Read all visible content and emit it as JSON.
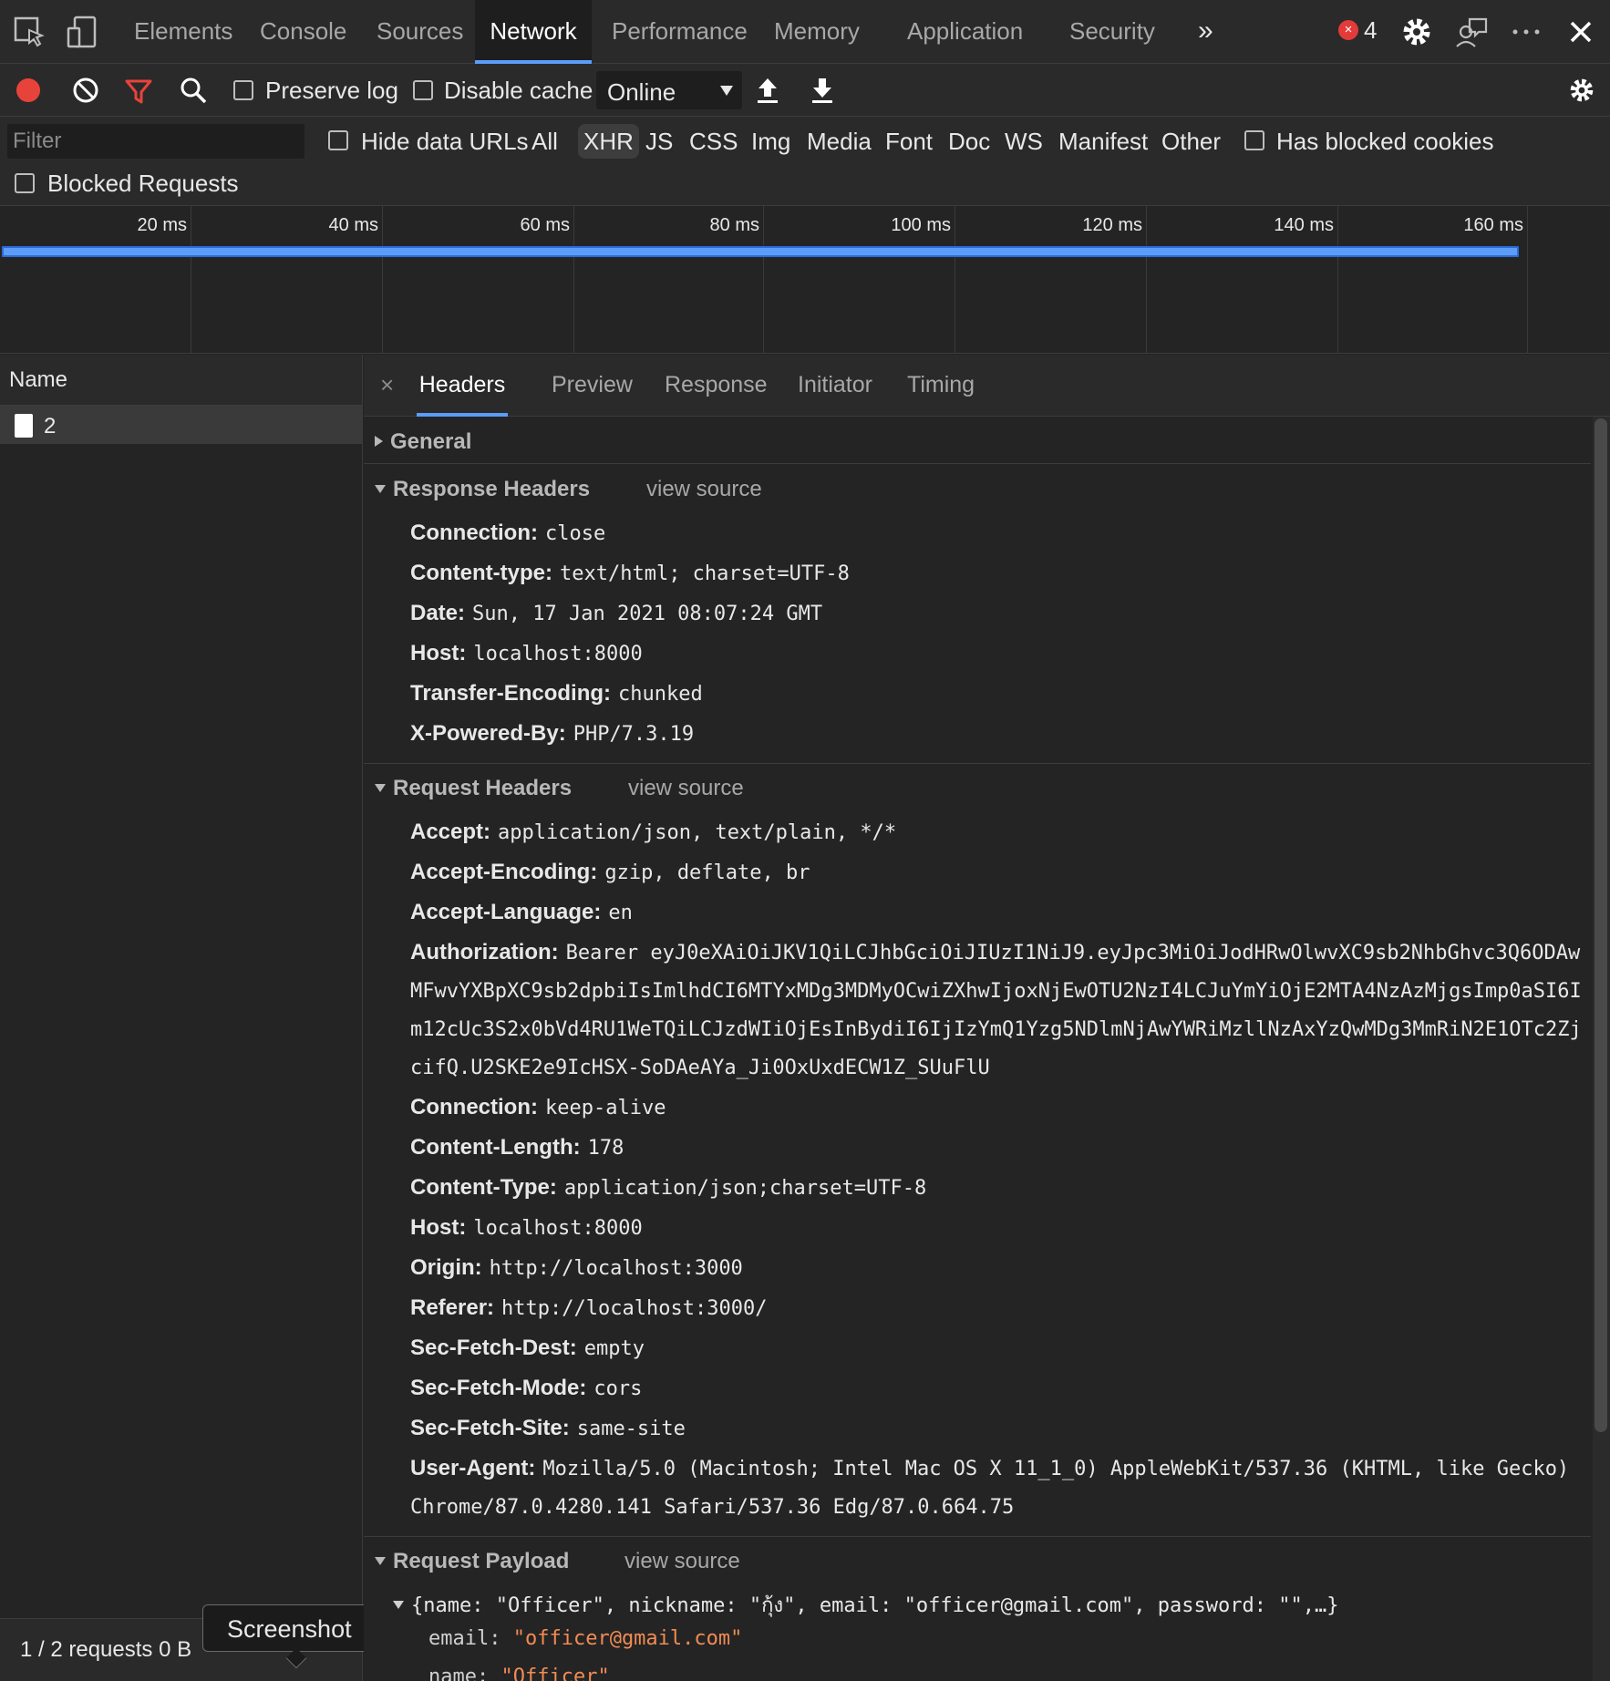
{
  "topbar": {
    "tabs": [
      "Elements",
      "Console",
      "Sources",
      "Network",
      "Performance",
      "Memory",
      "Application",
      "Security"
    ],
    "more": "»",
    "error_count": "4",
    "error_icon": "×"
  },
  "toolbar": {
    "preserve_log": "Preserve log",
    "disable_cache": "Disable cache",
    "throttle": "Online"
  },
  "filter": {
    "placeholder": "Filter",
    "hide_data_urls": "Hide data URLs",
    "types": [
      "All",
      "XHR",
      "JS",
      "CSS",
      "Img",
      "Media",
      "Font",
      "Doc",
      "WS",
      "Manifest",
      "Other"
    ],
    "active_type": "XHR",
    "has_blocked_cookies": "Has blocked cookies",
    "blocked_requests": "Blocked Requests"
  },
  "timeline": {
    "ticks": [
      "20 ms",
      "40 ms",
      "60 ms",
      "80 ms",
      "100 ms",
      "120 ms",
      "140 ms",
      "160 ms"
    ]
  },
  "requests": {
    "column": "Name",
    "items": [
      {
        "name": "2"
      }
    ],
    "status": "1 / 2 requests   0 B"
  },
  "tooltip": "Screenshot",
  "detail": {
    "close": "×",
    "tabs": [
      "Headers",
      "Preview",
      "Response",
      "Initiator",
      "Timing"
    ],
    "general": "General",
    "view_source": "view source",
    "response_headers": {
      "title": "Response Headers",
      "items": [
        {
          "k": "Connection:",
          "v": "close"
        },
        {
          "k": "Content-type:",
          "v": "text/html; charset=UTF-8"
        },
        {
          "k": "Date:",
          "v": "Sun, 17 Jan 2021 08:07:24 GMT"
        },
        {
          "k": "Host:",
          "v": "localhost:8000"
        },
        {
          "k": "Transfer-Encoding:",
          "v": "chunked"
        },
        {
          "k": "X-Powered-By:",
          "v": "PHP/7.3.19"
        }
      ]
    },
    "request_headers": {
      "title": "Request Headers",
      "accept": {
        "k": "Accept:",
        "v": "application/json, text/plain, */*"
      },
      "accept_encoding": {
        "k": "Accept-Encoding:",
        "v": "gzip, deflate, br"
      },
      "accept_language": {
        "k": "Accept-Language:",
        "v": "en"
      },
      "authorization": {
        "k": "Authorization:",
        "v1": "Bearer eyJ0eXAiOiJKV1QiLCJhbGciOiJIUzI1NiJ9.eyJpc3MiOiJodHRwOlwvXC9sb2NhbGhvc3Q6ODAw",
        "v2": "MFwvYXBpXC9sb2dpbiIsImlhdCI6MTYxMDg3MDMyOCwiZXhwIjoxNjEwOTU2NzI4LCJuYmYiOjE2MTA4NzAzMjgsImp0aSI6I",
        "v3": "m12cUc3S2x0bVd4RU1WeTQiLCJzdWIiOjEsInBydiI6IjIzYmQ1Yzg5NDlmNjAwYWRiMzllNzAxYzQwMDg3MmRiN2E1OTc2Zj",
        "v4": "cifQ.U2SKE2e9IcHSX-SoDAeAYa_Ji0OxUxdECW1Z_SUuFlU"
      },
      "rest": [
        {
          "k": "Connection:",
          "v": "keep-alive"
        },
        {
          "k": "Content-Length:",
          "v": "178"
        },
        {
          "k": "Content-Type:",
          "v": "application/json;charset=UTF-8"
        },
        {
          "k": "Host:",
          "v": "localhost:8000"
        },
        {
          "k": "Origin:",
          "v": "http://localhost:3000"
        },
        {
          "k": "Referer:",
          "v": "http://localhost:3000/"
        },
        {
          "k": "Sec-Fetch-Dest:",
          "v": "empty"
        },
        {
          "k": "Sec-Fetch-Mode:",
          "v": "cors"
        },
        {
          "k": "Sec-Fetch-Site:",
          "v": "same-site"
        }
      ],
      "user_agent": {
        "k": "User-Agent:",
        "v1": "Mozilla/5.0 (Macintosh; Intel Mac OS X 11_1_0) AppleWebKit/537.36 (KHTML, like Gecko)",
        "v2": "Chrome/87.0.4280.141 Safari/537.36 Edg/87.0.664.75"
      }
    },
    "payload": {
      "title": "Request Payload",
      "summary": "{name: \"Officer\", nickname: \"กุ้ง\", email: \"officer@gmail.com\", password: \"\",…}",
      "email_key": "email:",
      "email_val": "\"officer@gmail.com\"",
      "name_key": "name:",
      "name_val": "\"Officer\""
    }
  },
  "colors": {
    "accent": "#5b9df9",
    "record": "#e8433b",
    "filter": "#e8433b",
    "payload_value": "#f28b54"
  }
}
